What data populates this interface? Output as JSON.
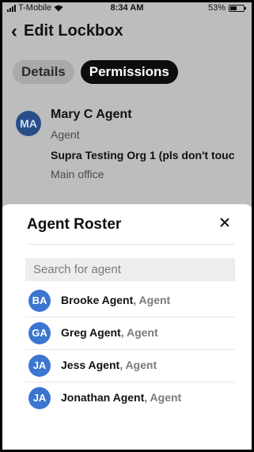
{
  "status_bar": {
    "carrier": "T-Mobile",
    "time": "8:34 AM",
    "battery": "53%",
    "battery_level": 0.53,
    "wifi_icon": "wifi-icon",
    "signal_icon": "signal-icon"
  },
  "nav": {
    "back_icon": "chevron-left-icon",
    "back_glyph": "‹",
    "title": "Edit Lockbox"
  },
  "tabs": [
    {
      "label": "Details",
      "active": false
    },
    {
      "label": "Permissions",
      "active": true
    }
  ],
  "agent": {
    "initials": "MA",
    "name": "Mary C Agent",
    "role": "Agent",
    "org": "Supra Testing Org 1 (pls don't touc",
    "office": "Main office"
  },
  "roster": {
    "title": "Agent Roster",
    "close_icon": "close-icon",
    "search_placeholder": "Search for agent",
    "items": [
      {
        "initials": "BA",
        "name": "Brooke Agent",
        "role": ", Agent"
      },
      {
        "initials": "GA",
        "name": "Greg Agent",
        "role": ", Agent"
      },
      {
        "initials": "JA",
        "name": "Jess Agent",
        "role": ", Agent"
      },
      {
        "initials": "JA",
        "name": "Jonathan Agent",
        "role": ", Agent"
      }
    ]
  },
  "colors": {
    "overlay_background": "#bdbdbd",
    "active_tab": "#0d0d0d",
    "avatar_blue": "#3a76d0",
    "avatar_dim": "#284e8a"
  }
}
